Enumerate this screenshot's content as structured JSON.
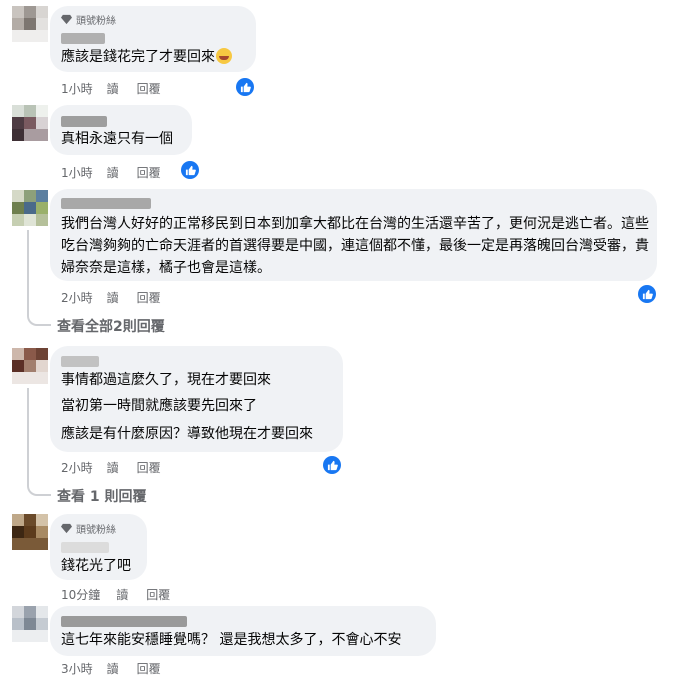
{
  "common": {
    "reply_label": "回覆",
    "read_label": "讀"
  },
  "comments": [
    {
      "badge": "頭號粉絲",
      "lines": [
        "應該是錢花完了才要回來"
      ],
      "has_emoji": true,
      "time": "1小時"
    },
    {
      "badge": "",
      "lines": [
        "真相永遠只有一個"
      ],
      "time": "1小時"
    },
    {
      "badge": "",
      "lines": [
        "我們台灣人好好的正常移民到日本到加拿大都比在台灣的生活還辛苦了，更何況是逃亡者。這些吃台灣夠夠的亡命天涯者的首選得要是中國，連這個都不懂，最後一定是再落魄回台灣受審，貴婦奈奈是這樣，橘子也會是這樣。"
      ],
      "time": "2小時",
      "view_replies": "查看全部2則回覆"
    },
    {
      "badge": "",
      "lines": [
        "事情都過這麼久了，現在才要回來",
        "當初第一時間就應該要先回來了",
        "應該是有什麼原因？導致他現在才要回來"
      ],
      "time": "2小時",
      "view_replies": "查看 1 則回覆"
    },
    {
      "badge": "頭號粉絲",
      "lines": [
        "錢花光了吧"
      ],
      "time": "10分鐘"
    },
    {
      "badge": "",
      "lines": [
        "這七年來能安穩睡覺嗎？ 還是我想太多了，不會心不安"
      ],
      "time": "3小時"
    }
  ]
}
